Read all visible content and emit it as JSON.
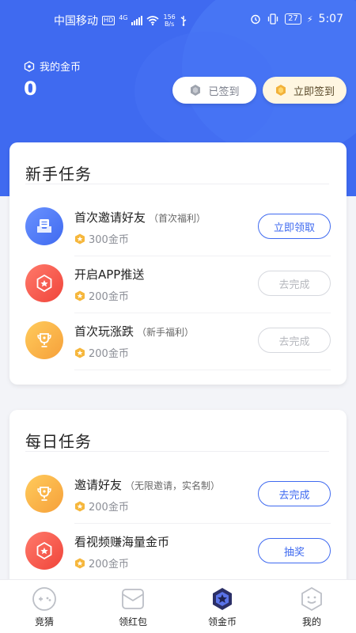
{
  "status_bar": {
    "carrier": "中国移动",
    "hd": "HD",
    "network": "4G",
    "speed_value": "156",
    "speed_unit": "B/s",
    "battery": "27",
    "time": "5:07"
  },
  "header": {
    "coin_label": "我的金币",
    "coin_count": "0",
    "signed_button": "已签到",
    "sign_now_button": "立即签到"
  },
  "newbie": {
    "title": "新手任务",
    "tasks": [
      {
        "title": "首次邀请好友",
        "note": "（首次福利）",
        "reward": "300金币",
        "button": "立即领取",
        "icon": "inbox-icon"
      },
      {
        "title": "开启APP推送",
        "note": "",
        "reward": "200金币",
        "button": "去完成",
        "icon": "star-badge-icon"
      },
      {
        "title": "首次玩涨跌",
        "note": "（新手福利）",
        "reward": "200金币",
        "button": "去完成",
        "icon": "trophy-icon"
      }
    ]
  },
  "daily": {
    "title": "每日任务",
    "tasks": [
      {
        "title": "邀请好友",
        "note": "（无限邀请，实名制）",
        "reward": "200金币",
        "button": "去完成",
        "icon": "trophy-icon"
      },
      {
        "title": "看视频赚海量金币",
        "note": "",
        "reward": "200金币",
        "button": "抽奖",
        "icon": "star-badge-icon"
      }
    ]
  },
  "tabbar": {
    "tabs": [
      {
        "label": "竞猜",
        "icon": "gamepad-icon"
      },
      {
        "label": "领红包",
        "icon": "envelope-icon"
      },
      {
        "label": "领金币",
        "icon": "coin-badge-icon"
      },
      {
        "label": "我的",
        "icon": "profile-face-icon"
      }
    ]
  },
  "colors": {
    "accent": "#3f6af0",
    "coin": "#f6b73c"
  }
}
